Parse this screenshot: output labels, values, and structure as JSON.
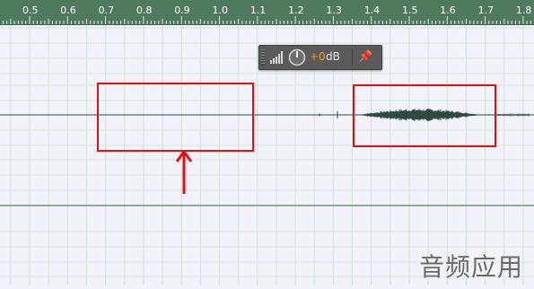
{
  "ruler": {
    "ticks": [
      "0.5",
      "0.6",
      "0.7",
      "0.8",
      "0.9",
      "1.0",
      "1.1",
      "1.2",
      "1.3",
      "1.4",
      "1.5",
      "1.6",
      "1.7",
      "1.8"
    ]
  },
  "gain_hud": {
    "value": "+0",
    "unit": "dB",
    "icons": [
      "volume-meter-icon",
      "volume-knob-icon",
      "pin-icon"
    ]
  },
  "watermark": "音频应用",
  "colors": {
    "ruler_bg": "#4f7a5e",
    "track_bg": "#f2f2fb",
    "grid": "#cfe2cf",
    "waveform": "#2f4a3f",
    "annotation": "#e01010",
    "gain_value": "#e2a12a"
  }
}
